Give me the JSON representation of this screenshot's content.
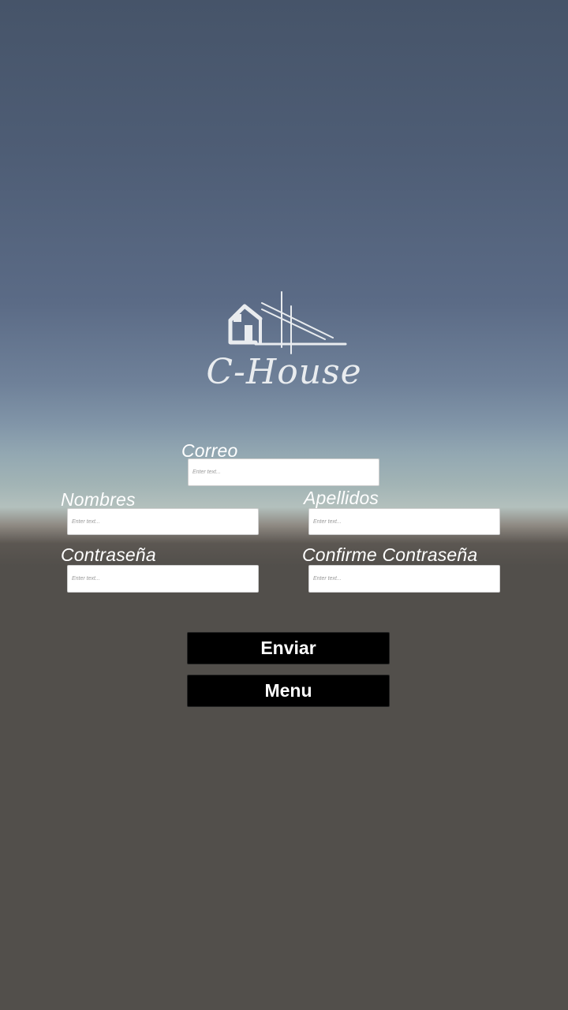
{
  "logo": {
    "text": "C-House",
    "color": "#e9ecef"
  },
  "form": {
    "correo": {
      "label": "Correo",
      "placeholder": "Enter text..."
    },
    "nombres": {
      "label": "Nombres",
      "placeholder": "Enter text..."
    },
    "apellidos": {
      "label": "Apellidos",
      "placeholder": "Enter text..."
    },
    "contrasena": {
      "label": "Contraseña",
      "placeholder": "Enter text..."
    },
    "confirme_contrasena": {
      "label": "Confirme Contraseña",
      "placeholder": "Enter text..."
    }
  },
  "buttons": {
    "enviar": "Enviar",
    "menu": "Menu"
  },
  "colors": {
    "sky_top": "#465469",
    "horizon": "#b3c0bd",
    "ground": "#524f4b",
    "button_bg": "#000000",
    "button_text": "#ffffff"
  }
}
